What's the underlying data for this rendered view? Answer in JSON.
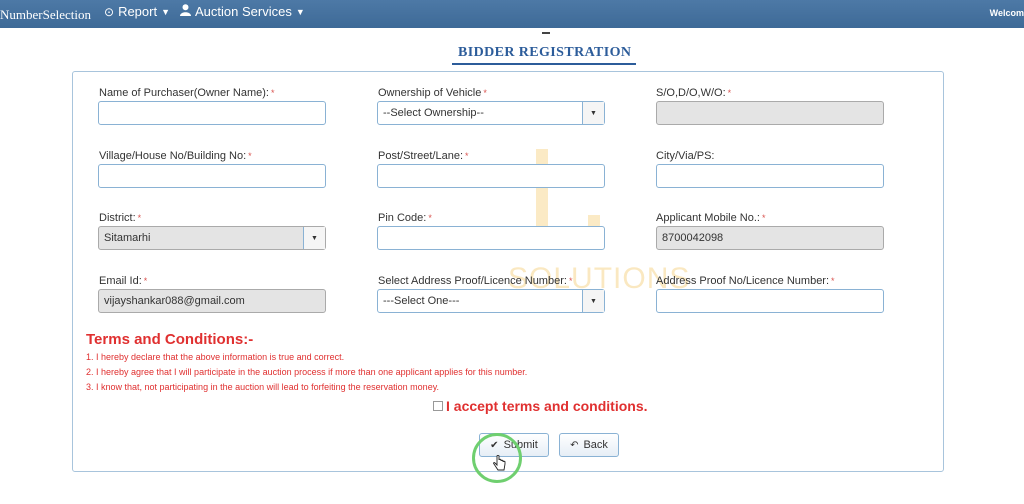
{
  "nav": {
    "brand": "NumberSelection",
    "report_label": "Report",
    "auction_label": "Auction Services",
    "welcome": "Welcom"
  },
  "page": {
    "title": "BIDDER REGISTRATION"
  },
  "form": {
    "owner_name_label": "Name of Purchaser(Owner Name):",
    "ownership_label": "Ownership of Vehicle",
    "ownership_value": "--Select Ownership--",
    "sodowo_label": "S/O,D/O,W/O:",
    "village_label": "Village/House No/Building No:",
    "post_label": "Post/Street/Lane:",
    "city_label": "City/Via/PS:",
    "district_label": "District:",
    "district_value": "Sitamarhi",
    "pin_label": "Pin Code:",
    "mobile_label": "Applicant Mobile No.:",
    "mobile_value": "8700042098",
    "email_label": "Email Id:",
    "email_value": "vijayshankar088@gmail.com",
    "proof_label": "Select Address Proof/Licence Number:",
    "proof_value": "---Select One---",
    "proof_no_label": "Address Proof No/Licence Number:",
    "required_mark": "*"
  },
  "terms": {
    "heading": "Terms and Conditions:-",
    "items": [
      "1. I hereby declare that the above information is true and correct.",
      "2. I hereby agree that I will participate in the auction process if more than one applicant applies for this number.",
      "3. I know that, not participating in the auction will lead to forfeiting the reservation money."
    ],
    "accept_label": "I accept terms and conditions."
  },
  "buttons": {
    "submit": "Submit",
    "back": "Back"
  },
  "watermark_text": "SOLUTIONS",
  "colors": {
    "navbar": "#4d79a6",
    "title": "#2c5c9a",
    "terms_red": "#e03030",
    "highlight_ring": "#6fcf6f"
  }
}
